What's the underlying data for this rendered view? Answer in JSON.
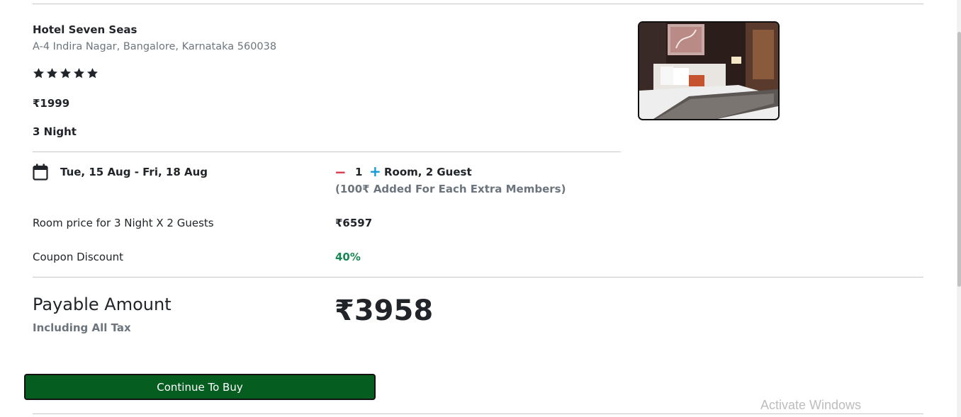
{
  "hotel": {
    "name": "Hotel Seven Seas",
    "address": "A-4 Indira Nagar, Bangalore, Karnataka 560038",
    "rating": 5,
    "price": "₹1999",
    "nights": "3 Night"
  },
  "booking": {
    "dates": "Tue, 15 Aug - Fri, 18 Aug",
    "minus_label": "−",
    "rooms_count": "1",
    "plus_label": "+",
    "room_guest": "Room, 2 Guest",
    "extra_note": "(100₹ Added For Each Extra Members)"
  },
  "pricing": {
    "room_price_label": "Room price for 3 Night X 2 Guests",
    "room_price_value": "₹6597",
    "coupon_label": "Coupon Discount",
    "coupon_value": "40%",
    "payable_label": "Payable Amount",
    "payable_sub": "Including All Tax",
    "payable_value": "₹3958"
  },
  "actions": {
    "continue_label": "Continue To Buy"
  },
  "os": {
    "watermark": "Activate Windows"
  },
  "colors": {
    "primary_button": "#055d20",
    "discount_green": "#198754",
    "minus_red": "#dc3545",
    "plus_blue": "#0d9bd6"
  }
}
